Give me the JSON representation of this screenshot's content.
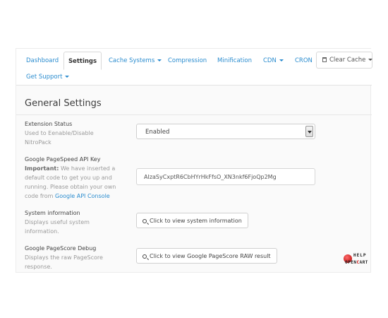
{
  "nav": {
    "tabs": [
      {
        "label": "Dashboard",
        "active": false
      },
      {
        "label": "Settings",
        "active": true
      },
      {
        "label": "Cache Systems",
        "dropdown": true
      },
      {
        "label": "Compression"
      },
      {
        "label": "Minification"
      },
      {
        "label": "CDN",
        "dropdown": true
      },
      {
        "label": "CRON"
      },
      {
        "label": "Clear Cache",
        "dropdown": true,
        "icon": "trash-icon"
      },
      {
        "label": "Get Support",
        "dropdown": true
      }
    ]
  },
  "main": {
    "section_title": "General Settings",
    "rows": [
      {
        "title": "Extension Status",
        "desc": "Used to Eenable/Disable NitroPack",
        "control": "select",
        "value": "Enabled"
      },
      {
        "title": "Google PageSpeed API Key",
        "desc_bold": "Important:",
        "desc": " We have inserted a default code to get you up and running. Please obtain your own code from ",
        "desc_link": "Google API Console",
        "control": "input",
        "value": "AIzaSyCxptR6CbHYrHkFfsO_XN3nkf6FjoQp2Mg"
      },
      {
        "title": "System information",
        "desc": "Displays useful system information.",
        "control": "button",
        "button_label": "Click to view system information",
        "icon": "search-icon"
      },
      {
        "title": "Google PageScore Debug",
        "desc": "Displays the raw PageScore response.",
        "control": "button",
        "button_label": "Click to view Google PageScore RAW result",
        "icon": "search-icon"
      }
    ]
  },
  "watermark": {
    "top": "HELP",
    "bottom_a": "OPEN",
    "bottom_b": "C",
    "bottom_c": "ART"
  },
  "colors": {
    "link": "#2a8ccf",
    "text": "#444444",
    "muted": "#9a9a9a"
  }
}
